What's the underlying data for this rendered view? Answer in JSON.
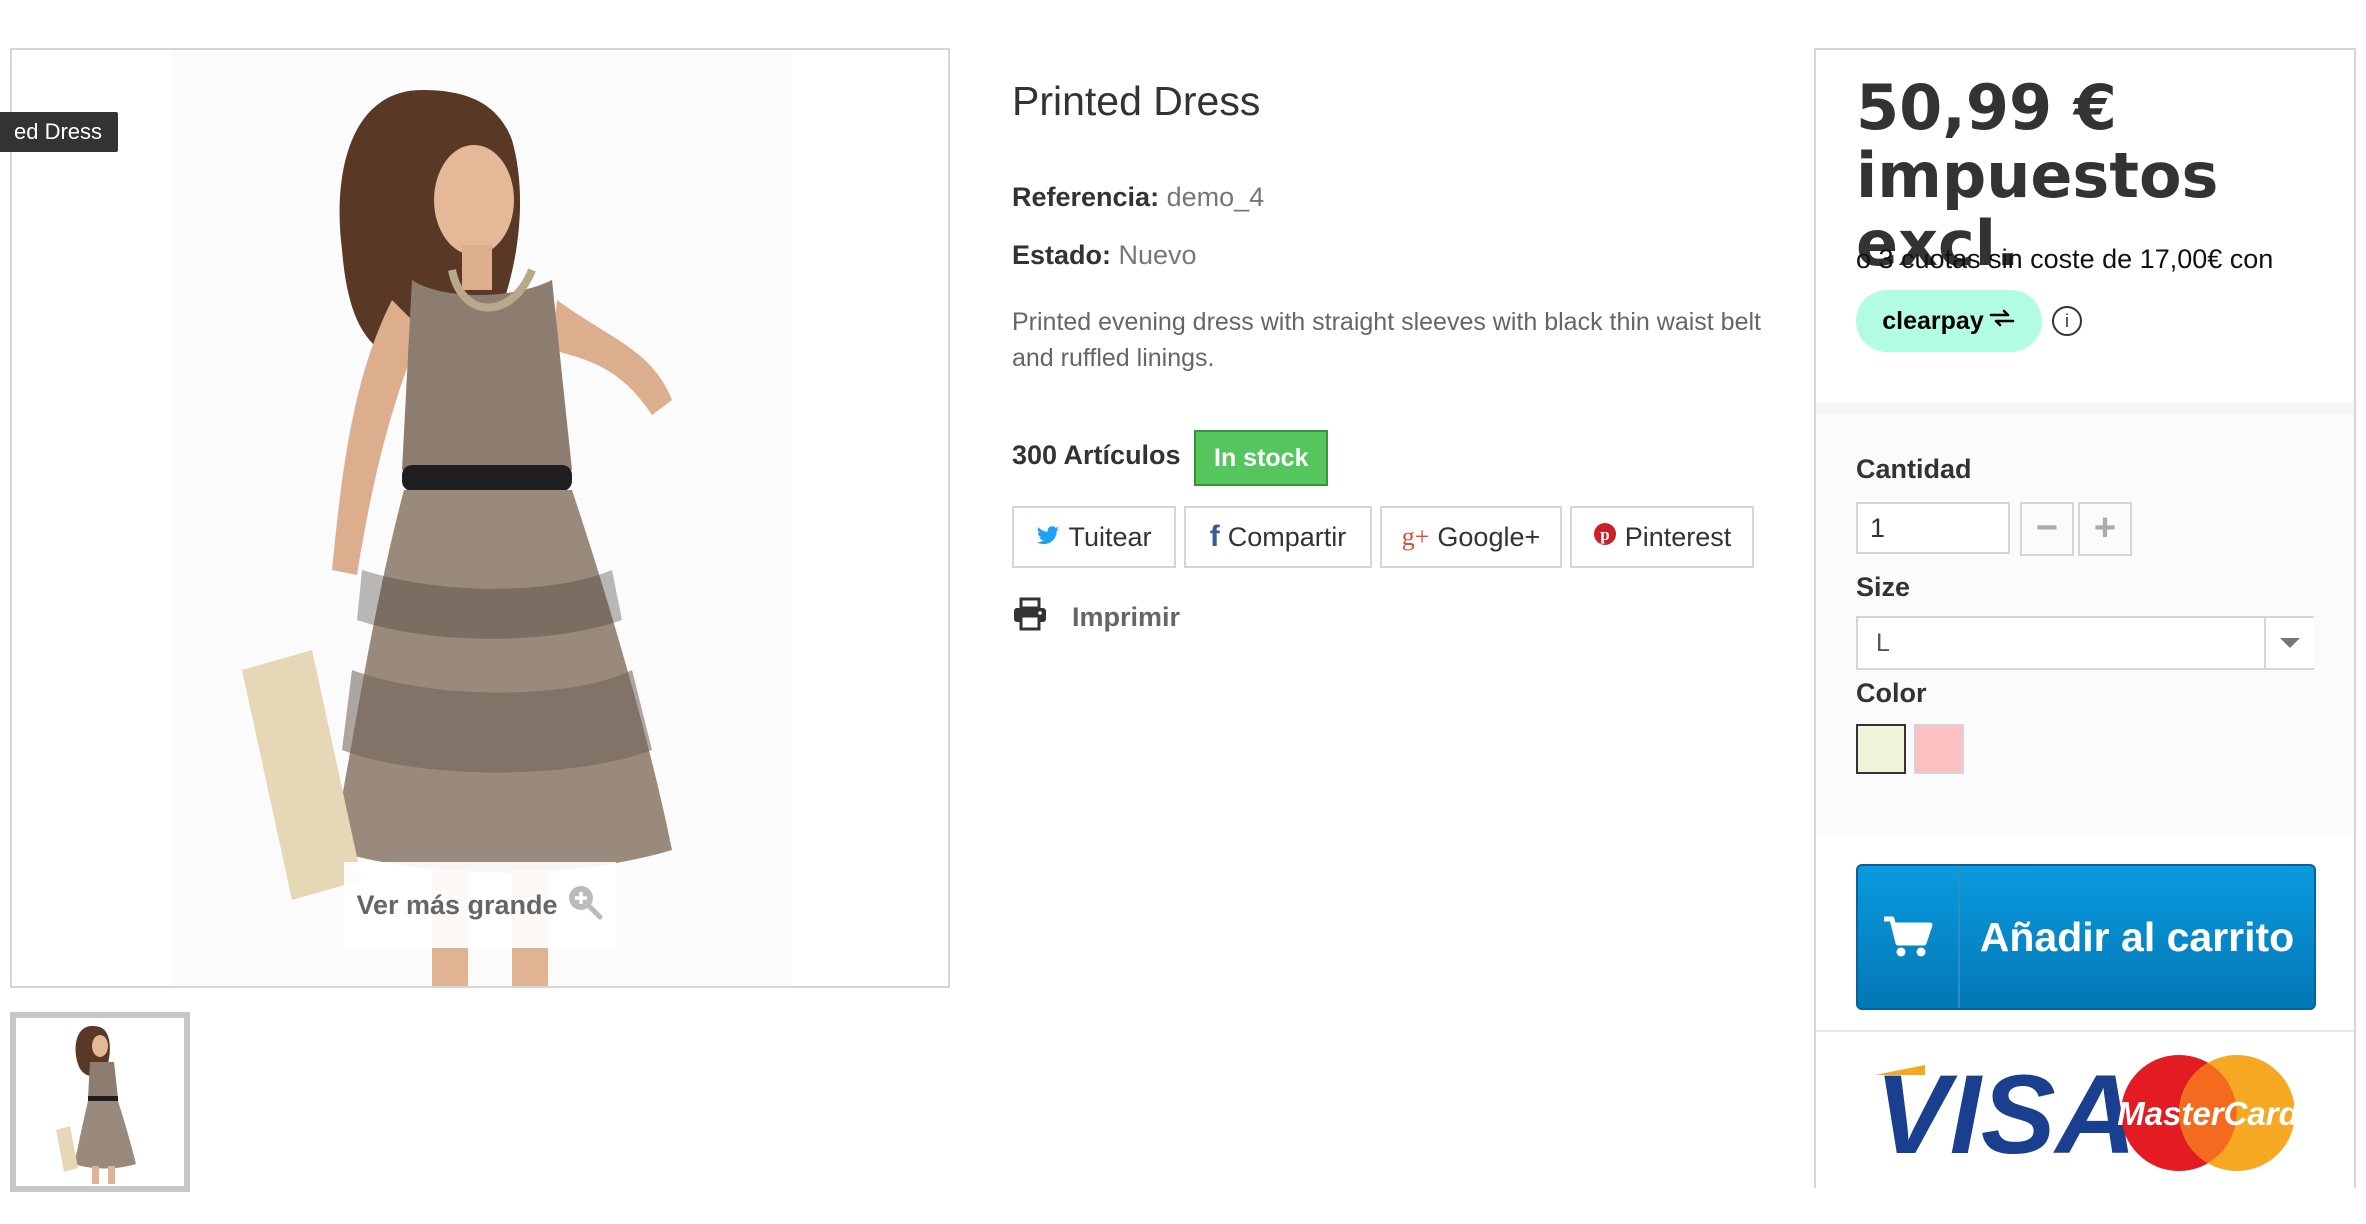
{
  "image": {
    "label": "ed Dress",
    "zoom_label": "Ver más grande"
  },
  "product": {
    "title": "Printed Dress",
    "reference_label": "Referencia:",
    "reference_value": "demo_4",
    "condition_label": "Estado:",
    "condition_value": "Nuevo",
    "description": "Printed evening dress with straight sleeves with black thin waist belt and ruffled linings.",
    "quantity_text": "300 Artículos",
    "stock_badge": "In stock"
  },
  "social": {
    "twitter": "Tuitear",
    "facebook": "Compartir",
    "google": "Google+",
    "pinterest": "Pinterest"
  },
  "print_label": "Imprimir",
  "buy_box": {
    "price": "50,99 € impuestos excl.",
    "installments": "o 3 cuotas sin coste de 17,00€ con",
    "clearpay": "clearpay",
    "info_icon": "ⓘ",
    "quantity_label": "Cantidad",
    "quantity_value": "1",
    "minus": "−",
    "plus": "+",
    "size_label": "Size",
    "size_value": "L",
    "color_label": "Color",
    "color_swatches": [
      "#f2f3db",
      "#fcc0c2"
    ],
    "add_to_cart": "Añadir al carrito",
    "cards": {
      "visa": "VISA",
      "mastercard": "MasterCard"
    }
  },
  "colors": {
    "stock_green": "#55c65e",
    "cart_blue": "#0a8ed0",
    "clearpay_mint": "#b2fce4"
  }
}
